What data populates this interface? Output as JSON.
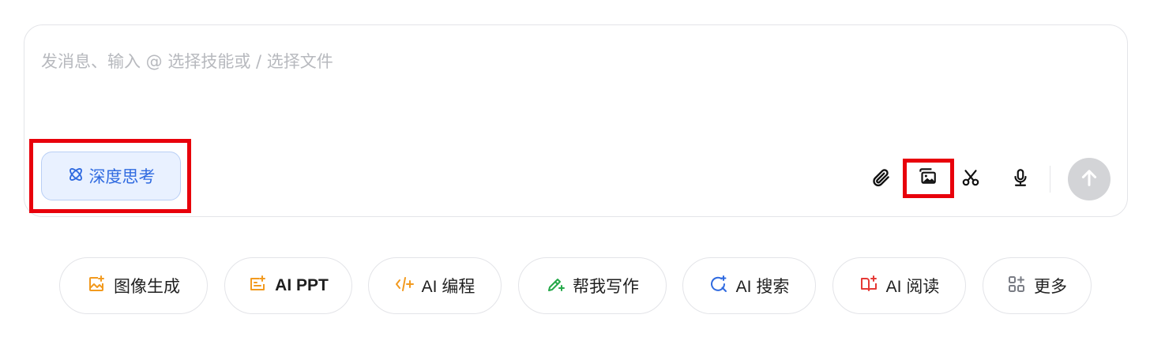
{
  "composer": {
    "placeholder": "发消息、输入 @ 选择技能或 / 选择文件",
    "value": "",
    "deep_think_label": "深度思考"
  },
  "toolbar": {
    "icons": [
      "paperclip-icon",
      "image-upload-icon",
      "scissors-icon",
      "microphone-icon",
      "arrow-up-icon"
    ]
  },
  "shortcuts": [
    {
      "label": "图像生成",
      "icon": "image-sparkle-icon",
      "color": "#f29a1f"
    },
    {
      "label": "AI PPT",
      "icon": "slides-icon",
      "color": "#f29a1f"
    },
    {
      "label": "AI 编程",
      "icon": "code-icon",
      "color": "#f29a1f"
    },
    {
      "label": "帮我写作",
      "icon": "pen-sparkle-icon",
      "color": "#26a94a"
    },
    {
      "label": "AI 搜索",
      "icon": "search-sparkle-icon",
      "color": "#2f6ae0"
    },
    {
      "label": "AI 阅读",
      "icon": "book-sparkle-icon",
      "color": "#e53935"
    },
    {
      "label": "更多",
      "icon": "grid-plus-icon",
      "color": "#7a7d85"
    }
  ],
  "colors": {
    "accent": "#2f6ae0",
    "highlight": "#e8000b",
    "border": "#e3e4e8",
    "send_disabled": "#d3d4d7"
  }
}
